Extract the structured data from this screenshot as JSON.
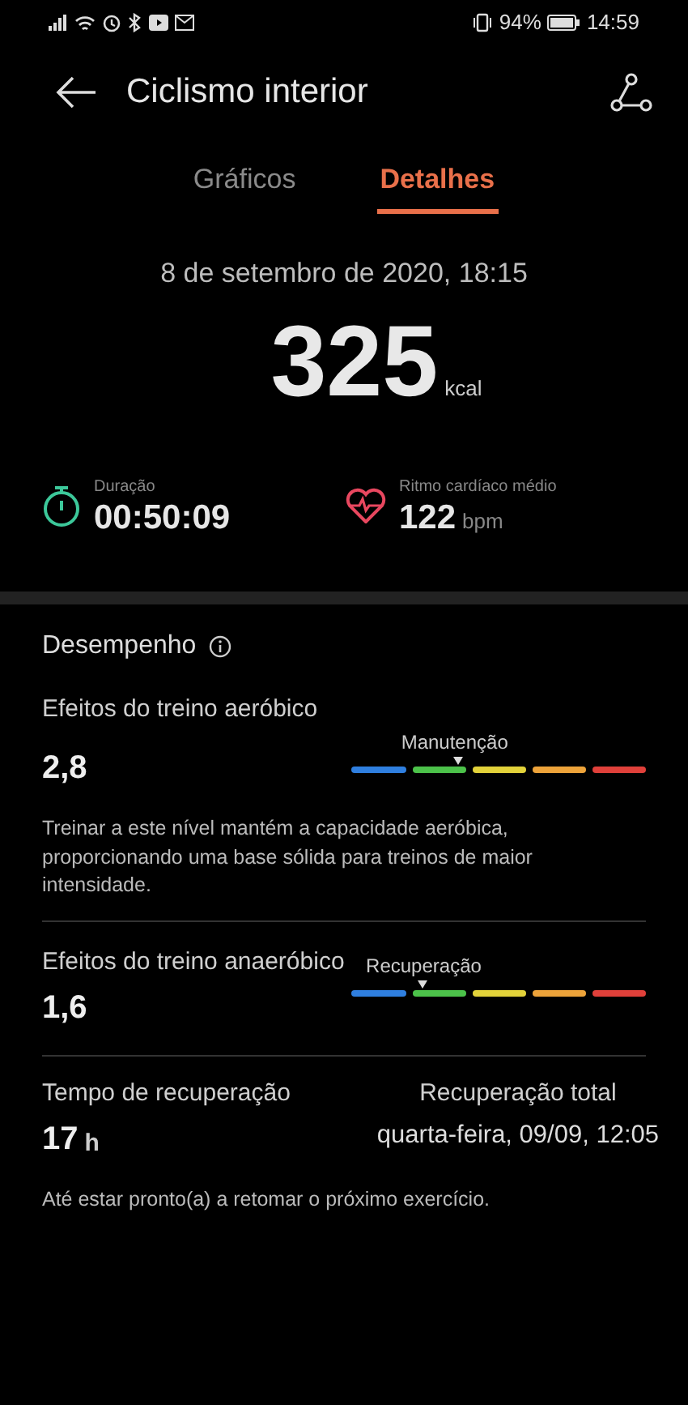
{
  "status_bar": {
    "battery_percent": "94%",
    "time": "14:59"
  },
  "header": {
    "title": "Ciclismo interior"
  },
  "tabs": [
    {
      "label": "Gráficos",
      "selected": false
    },
    {
      "label": "Detalhes",
      "selected": true
    }
  ],
  "summary": {
    "datetime": "8 de setembro de 2020, 18:15",
    "calories": "325",
    "calories_unit": "kcal"
  },
  "stats": [
    {
      "kind": "duration",
      "label": "Duração",
      "value": "00:50:09"
    },
    {
      "kind": "heart",
      "label": "Ritmo cardíaco médio",
      "value": "122",
      "unit": "bpm"
    }
  ],
  "performance": {
    "title": "Desempenho",
    "effects": [
      {
        "title": "Efeitos do treino aeróbico",
        "value": "2,8",
        "scale_label": "Manutenção",
        "level": 0.36,
        "description": "Treinar a este nível mantém a capacidade aeróbica, proporcionando uma base sólida para treinos de maior intensidade."
      },
      {
        "title": "Efeitos do treino anaeróbico",
        "value": "1,6",
        "scale_label": "Recuperação",
        "level": 0.24
      }
    ],
    "recovery": {
      "title": "Tempo de recuperação",
      "value": "17",
      "unit": "h",
      "total_label": "Recuperação total",
      "total_value": "quarta-feira, 09/09, 12:05",
      "note": "Até estar pronto(a) a retomar o próximo exercício."
    }
  }
}
